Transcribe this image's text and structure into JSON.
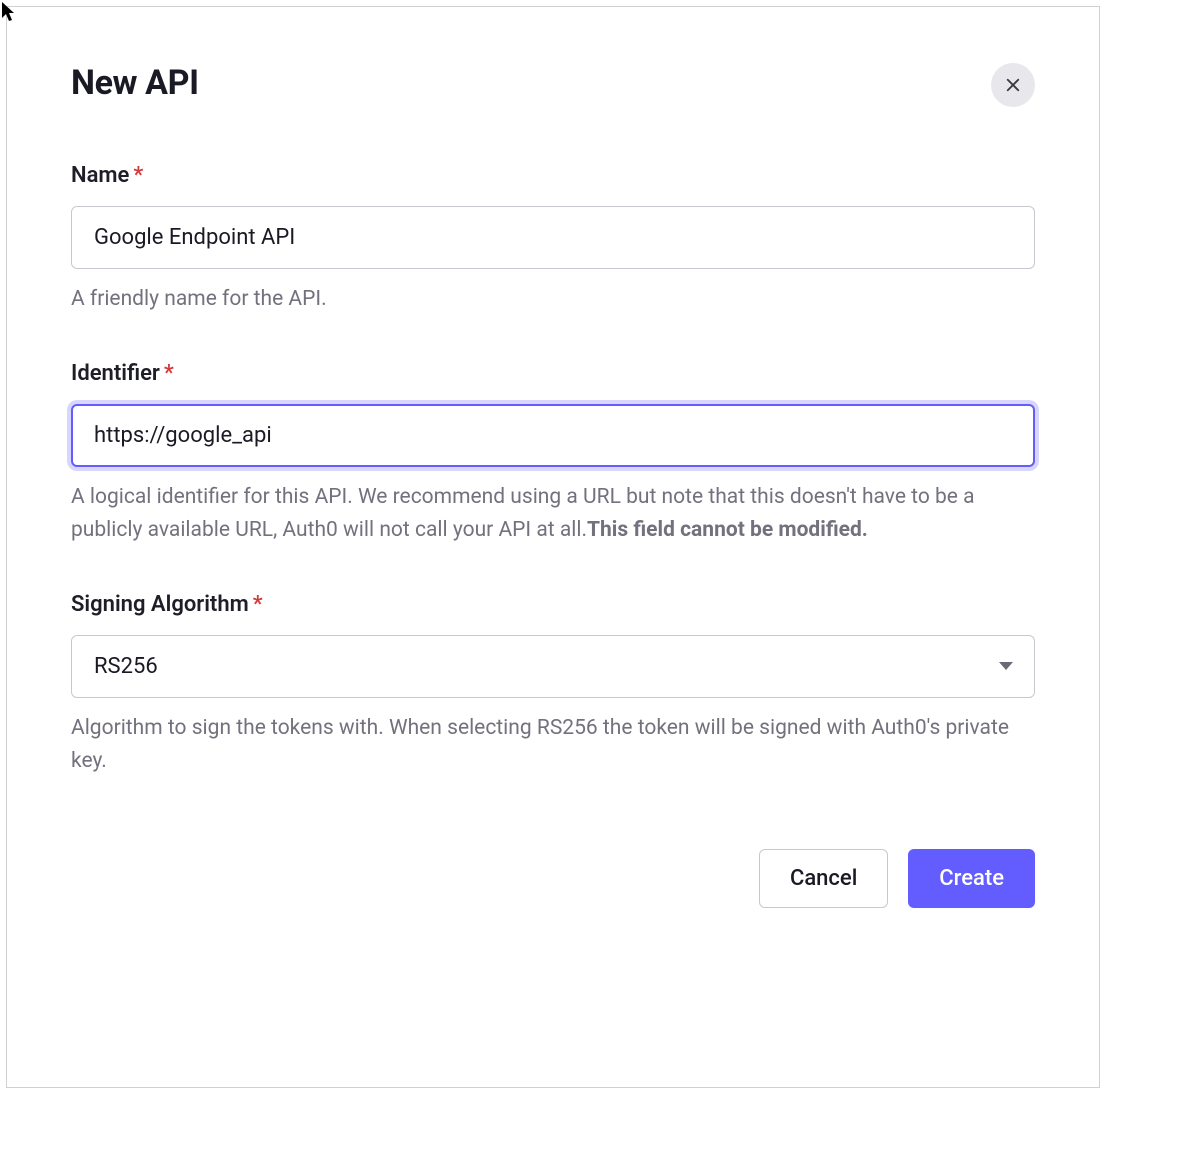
{
  "dialog": {
    "title": "New API",
    "fields": {
      "name": {
        "label": "Name",
        "value": "Google Endpoint API",
        "helper": "A friendly name for the API."
      },
      "identifier": {
        "label": "Identifier",
        "value": "https://google_api",
        "helper_part1": "A logical identifier for this API. We recommend using a URL but note that this doesn't have to be a publicly available URL, Auth0 will not call your API at all.",
        "helper_bold": "This field cannot be modified."
      },
      "signing_algorithm": {
        "label": "Signing Algorithm",
        "value": "RS256",
        "helper": "Algorithm to sign the tokens with. When selecting RS256 the token will be signed with Auth0's private key."
      }
    },
    "footer": {
      "cancel": "Cancel",
      "create": "Create"
    }
  }
}
